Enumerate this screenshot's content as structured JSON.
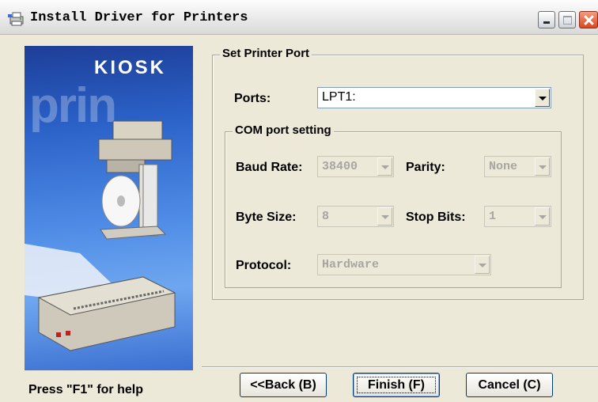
{
  "window": {
    "title": "Install Driver for Printers"
  },
  "side_image": {
    "brand": "KIOSK",
    "background_word": "prin"
  },
  "port_group": {
    "legend": "Set Printer Port",
    "ports_label": "Ports:",
    "ports_value": "LPT1:"
  },
  "com_group": {
    "legend": "COM port setting",
    "baud_rate_label": "Baud Rate:",
    "baud_rate_value": "38400",
    "parity_label": "Parity:",
    "parity_value": "None",
    "byte_size_label": "Byte Size:",
    "byte_size_value": "8",
    "stop_bits_label": "Stop Bits:",
    "stop_bits_value": "1",
    "protocol_label": "Protocol:",
    "protocol_value": "Hardware"
  },
  "footer": {
    "help_text": "Press \"F1\" for help",
    "back_label": "<<Back (B)",
    "finish_label": "Finish (F)",
    "cancel_label": "Cancel (C)"
  },
  "colors": {
    "dialog_bg": "#ece9d8",
    "title_gradient_top": "#fdfdfd",
    "close_button": "#d9481f",
    "image_blue": "#2b62c8"
  },
  "icons": [
    "printer-app-icon",
    "minimize-icon",
    "maximize-icon",
    "close-icon",
    "dropdown-arrow-icon"
  ]
}
